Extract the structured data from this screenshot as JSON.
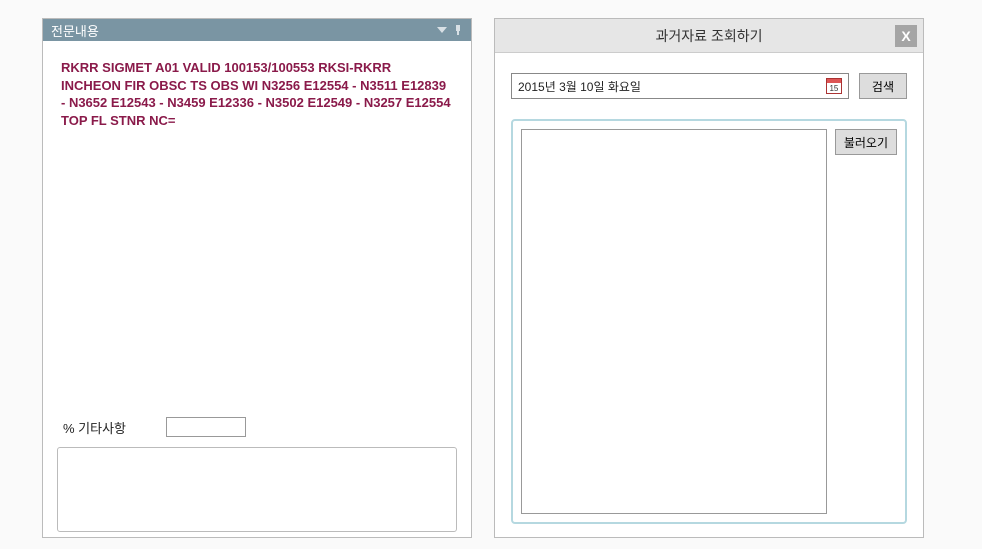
{
  "leftPanel": {
    "title": "전문내용",
    "message": "RKRR SIGMET A01 VALID 100153/100553 RKSI-RKRR INCHEON FIR OBSC TS OBS WI N3256 E12554 - N3511 E12839 - N3652 E12543 - N3459 E12336 - N3502 E12549 - N3257 E12554 TOP FL STNR NC=",
    "extraLabel": "% 기타사항"
  },
  "rightPanel": {
    "title": "과거자료 조회하기",
    "closeLabel": "X",
    "dateText": "2015년 3월 10일 화요일",
    "calendarDay": "15",
    "searchLabel": "검색",
    "loadLabel": "불러오기"
  }
}
